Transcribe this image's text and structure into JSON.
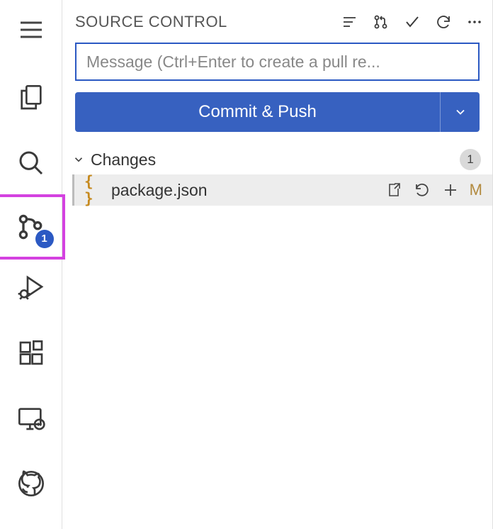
{
  "activityBar": {
    "scmBadge": "1"
  },
  "header": {
    "title": "SOURCE CONTROL"
  },
  "commit": {
    "placeholder": "Message (Ctrl+Enter to create a pull re...",
    "buttonLabel": "Commit & Push"
  },
  "changes": {
    "title": "Changes",
    "count": "1",
    "files": [
      {
        "name": "package.json",
        "status": "M"
      }
    ]
  }
}
